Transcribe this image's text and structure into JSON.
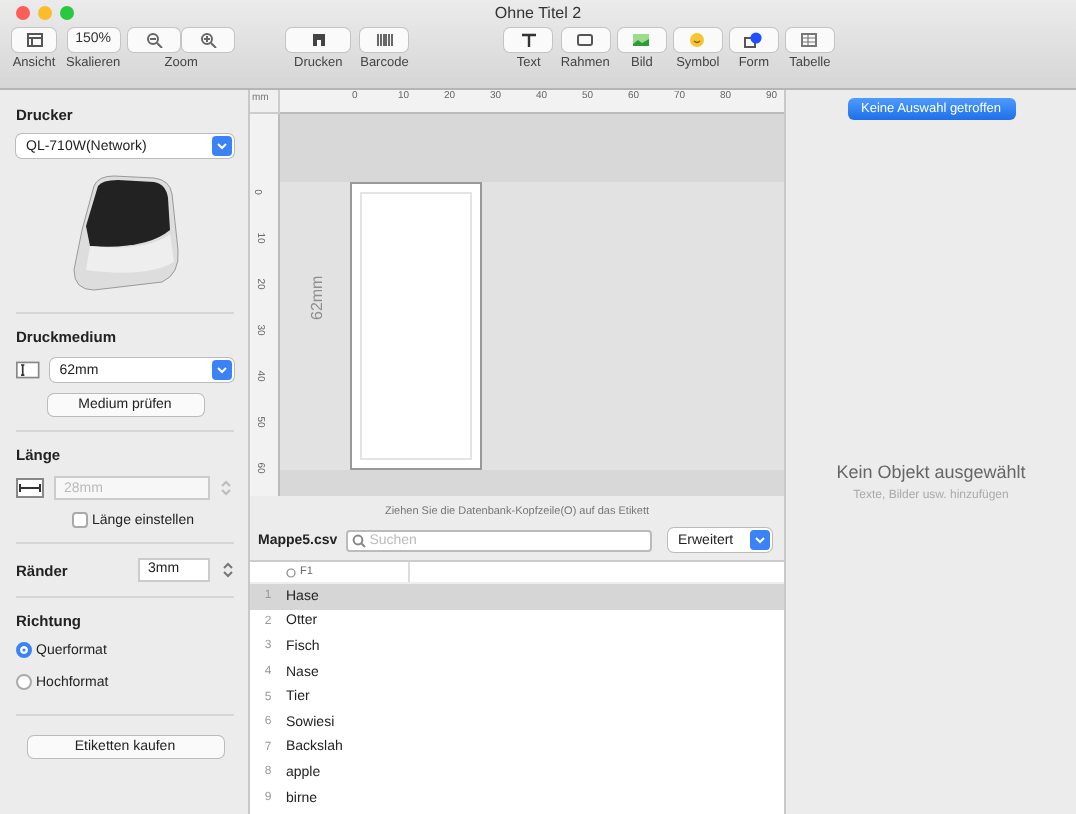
{
  "window": {
    "title": "Ohne Titel 2"
  },
  "toolbar": {
    "view": {
      "label": "Ansicht"
    },
    "scale": {
      "value": "150%",
      "label": "Skalieren"
    },
    "zoom": {
      "label": "Zoom"
    },
    "print": {
      "label": "Drucken"
    },
    "barcode": {
      "label": "Barcode"
    },
    "text": {
      "label": "Text"
    },
    "frame": {
      "label": "Rahmen"
    },
    "image": {
      "label": "Bild"
    },
    "symbol": {
      "label": "Symbol"
    },
    "shape": {
      "label": "Form"
    },
    "table": {
      "label": "Tabelle"
    }
  },
  "sidebar": {
    "printer": {
      "heading": "Drucker",
      "value": "QL-710W(Network)"
    },
    "media": {
      "heading": "Druckmedium",
      "value": "62mm",
      "button": "Medium prüfen"
    },
    "length": {
      "heading": "Länge",
      "placeholder": "28mm",
      "checkbox": "Länge einstellen",
      "checked": false
    },
    "margins": {
      "heading": "Ränder",
      "value": "3mm"
    },
    "orientation": {
      "heading": "Richtung",
      "options": [
        {
          "label": "Querformat",
          "selected": true
        },
        {
          "label": "Hochformat",
          "selected": false
        }
      ]
    },
    "buy_button": "Etiketten kaufen"
  },
  "canvas": {
    "unit": "mm",
    "top_ruler": [
      "0",
      "10",
      "20",
      "30",
      "40",
      "50",
      "60",
      "70",
      "80",
      "90"
    ],
    "left_ruler": [
      "0",
      "10",
      "20",
      "30",
      "40",
      "50",
      "60"
    ],
    "label_size": "62mm"
  },
  "database": {
    "hint": "Ziehen Sie die Datenbank-Kopfzeile(O) auf das Etikett",
    "file": "Mappe5.csv",
    "search_placeholder": "Suchen",
    "mode": "Erweitert",
    "column": "F1",
    "rows": [
      {
        "number": "1",
        "value": "Hase",
        "selected": true
      },
      {
        "number": "2",
        "value": "Otter",
        "selected": false
      },
      {
        "number": "3",
        "value": "Fisch",
        "selected": false
      },
      {
        "number": "4",
        "value": "Nase",
        "selected": false
      },
      {
        "number": "5",
        "value": "Tier",
        "selected": false
      },
      {
        "number": "6",
        "value": "Sowiesi",
        "selected": false
      },
      {
        "number": "7",
        "value": "Backslah",
        "selected": false
      },
      {
        "number": "8",
        "value": "apple",
        "selected": false
      },
      {
        "number": "9",
        "value": "birne",
        "selected": false
      }
    ]
  },
  "inspector": {
    "selection_button": "Keine Auswahl getroffen",
    "empty_title": "Kein Objekt ausgewählt",
    "empty_hint": "Texte, Bilder usw. hinzufügen"
  }
}
